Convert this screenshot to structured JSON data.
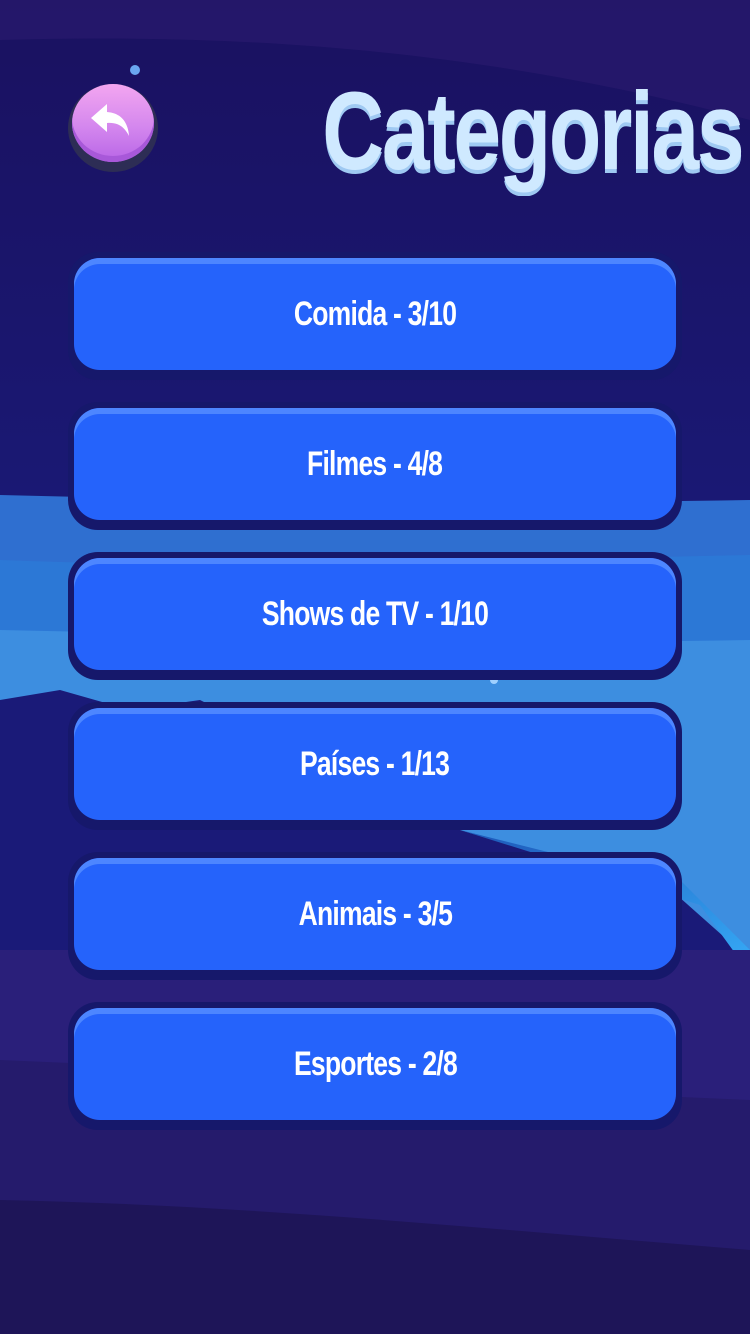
{
  "screen": {
    "title": "Categorias",
    "back_button_icon": "undo-arrow-icon"
  },
  "categories": [
    {
      "label": "Comida - 3/10",
      "name": "Comida",
      "progress": "3/10"
    },
    {
      "label": "Filmes - 4/8",
      "name": "Filmes",
      "progress": "4/8"
    },
    {
      "label": "Shows de TV - 1/10",
      "name": "Shows de TV",
      "progress": "1/10"
    },
    {
      "label": "Países - 1/13",
      "name": "Países",
      "progress": "1/13"
    },
    {
      "label": "Animais - 3/5",
      "name": "Animais",
      "progress": "3/5"
    },
    {
      "label": "Esportes - 2/8",
      "name": "Esportes",
      "progress": "2/8"
    }
  ],
  "colors": {
    "button_face": "#2563fb",
    "button_border": "#16186b",
    "title": "#cfe9ff",
    "back_button": "#d487ee",
    "sky_top": "#1c1566",
    "ground": "#2a1f7a"
  }
}
